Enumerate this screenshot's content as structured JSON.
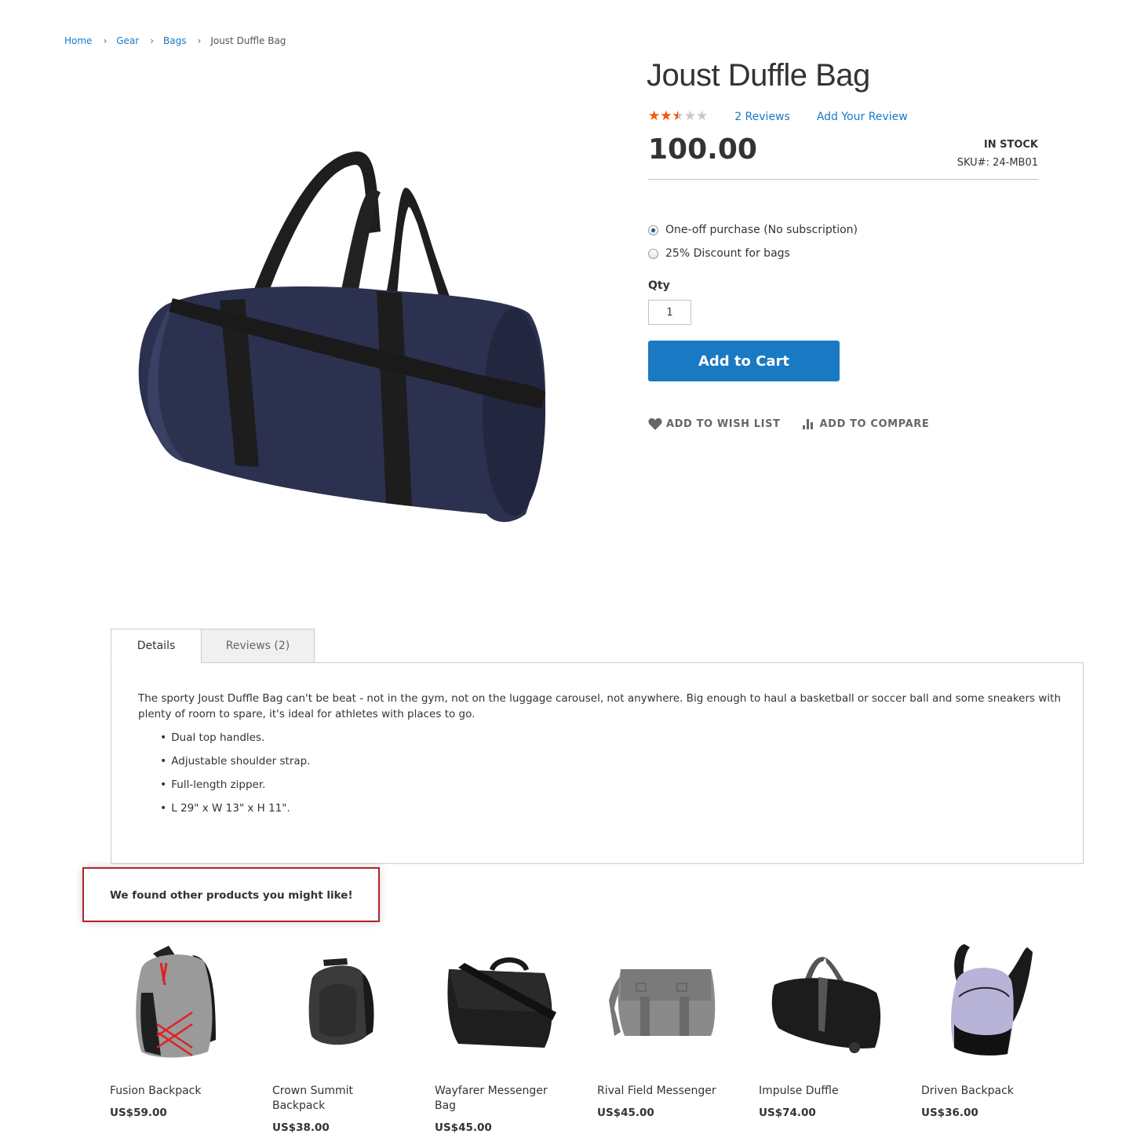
{
  "breadcrumb": [
    {
      "label": "Home"
    },
    {
      "label": "Gear"
    },
    {
      "label": "Bags"
    },
    {
      "label": "Joust Duffle Bag"
    }
  ],
  "product": {
    "title": "Joust Duffle Bag",
    "rating_fraction": 0.5,
    "stars_glyph": "★★★★★",
    "reviews_link": "2  Reviews",
    "add_review_link": "Add Your Review",
    "price": "100.00",
    "stock": "IN STOCK",
    "sku": "SKU#:  24-MB01",
    "image_icon": "duffle-bag-image"
  },
  "purchase_options": [
    {
      "label": "One-off purchase (No subscription)",
      "checked": true
    },
    {
      "label": "25% Discount for bags",
      "checked": false
    }
  ],
  "qty": {
    "label": "Qty",
    "value": "1"
  },
  "add_to_cart": "Add to Cart",
  "actions": {
    "wishlist": "ADD TO WISH LIST",
    "compare": "ADD TO COMPARE"
  },
  "tabs": [
    {
      "label": "Details",
      "active": true
    },
    {
      "label": "Reviews (2)",
      "active": false
    }
  ],
  "details": {
    "description": "The sporty Joust Duffle Bag can't be beat - not in the gym, not on the luggage carousel, not anywhere. Big enough to haul a basketball or soccer ball and some sneakers with plenty of room to spare, it's ideal for athletes with places to go.",
    "features": [
      "Dual top handles.",
      "Adjustable shoulder strap.",
      "Full-length zipper.",
      "L 29\" x W 13\" x H 11\"."
    ]
  },
  "related": {
    "title": "We found other products you might like!",
    "highlight_color": "#b0232a",
    "products": [
      {
        "name": "Fusion Backpack",
        "price": "US$59.00",
        "icon": "backpack-icon"
      },
      {
        "name": "Crown Summit Backpack",
        "price": "US$38.00",
        "icon": "backpack-icon"
      },
      {
        "name": "Wayfarer Messenger Bag",
        "price": "US$45.00",
        "icon": "messenger-bag-icon"
      },
      {
        "name": "Rival Field Messenger",
        "price": "US$45.00",
        "icon": "messenger-bag-icon"
      },
      {
        "name": "Impulse Duffle",
        "price": "US$74.00",
        "icon": "duffle-icon"
      },
      {
        "name": "Driven Backpack",
        "price": "US$36.00",
        "icon": "backpack-icon"
      }
    ]
  },
  "colors": {
    "link": "#1979c3",
    "button": "#1979c3",
    "star_filled": "#ff5501",
    "star_empty": "#c7c7c7"
  }
}
